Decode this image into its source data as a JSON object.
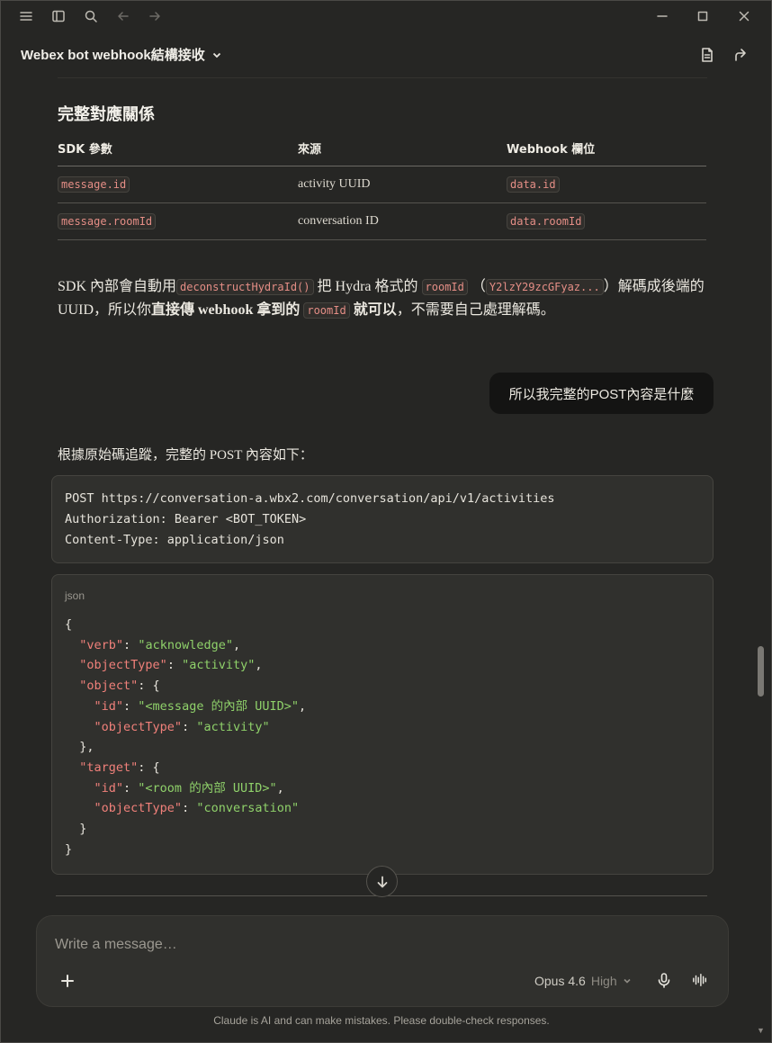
{
  "window": {
    "icons": [
      "menu-icon",
      "sidebar-icon",
      "search-icon",
      "back-icon",
      "forward-icon",
      "minimize-icon",
      "maximize-icon",
      "close-icon"
    ]
  },
  "header": {
    "title": "Webex bot webhook結構接收",
    "icons": [
      "document-icon",
      "share-icon"
    ]
  },
  "section": {
    "heading": "完整對應關係",
    "table": {
      "headers": [
        "SDK 參數",
        "來源",
        "Webhook 欄位"
      ],
      "rows": [
        [
          "message.id",
          "activity UUID",
          "data.id"
        ],
        [
          "message.roomId",
          "conversation ID",
          "data.roomId"
        ]
      ]
    }
  },
  "paragraph": {
    "p1": "SDK 內部會自動用",
    "code1": "deconstructHydraId()",
    "p2": "把 Hydra 格式的",
    "code2": "roomId",
    "p3": "（",
    "code3": "Y2lzY29zcGFyaz...",
    "p4": "）解碼成後端的 UUID，所以你",
    "bold1": "直接傳 webhook 拿到的",
    "code4": "roomId",
    "bold2": "就可以",
    "p5": "，不需要自己處理解碼。"
  },
  "user_message": "所以我完整的POST內容是什麼",
  "assistant": {
    "intro": "根據原始碼追蹤，完整的 POST 內容如下：",
    "request_lines": [
      "POST https://conversation-a.wbx2.com/conversation/api/v1/activities",
      "Authorization: Bearer <BOT_TOKEN>",
      "Content-Type: application/json"
    ],
    "json_lang": "json",
    "json_body": {
      "l1": "{",
      "verb_key": "\"verb\"",
      "verb_val": "\"acknowledge\"",
      "ot_key": "\"objectType\"",
      "ot_val": "\"activity\"",
      "obj_key": "\"object\"",
      "id_key": "\"id\"",
      "obj_id_val": "\"<message 的內部 UUID>\"",
      "obj_ot_val": "\"activity\"",
      "target_key": "\"target\"",
      "target_id_val": "\"<room 的內部 UUID>\"",
      "target_ot_val": "\"conversation\""
    }
  },
  "composer": {
    "placeholder": "Write a message…",
    "model": "Opus 4.6",
    "effort": "High"
  },
  "disclaimer": "Claude is AI and can make mistakes. Please double-check responses."
}
